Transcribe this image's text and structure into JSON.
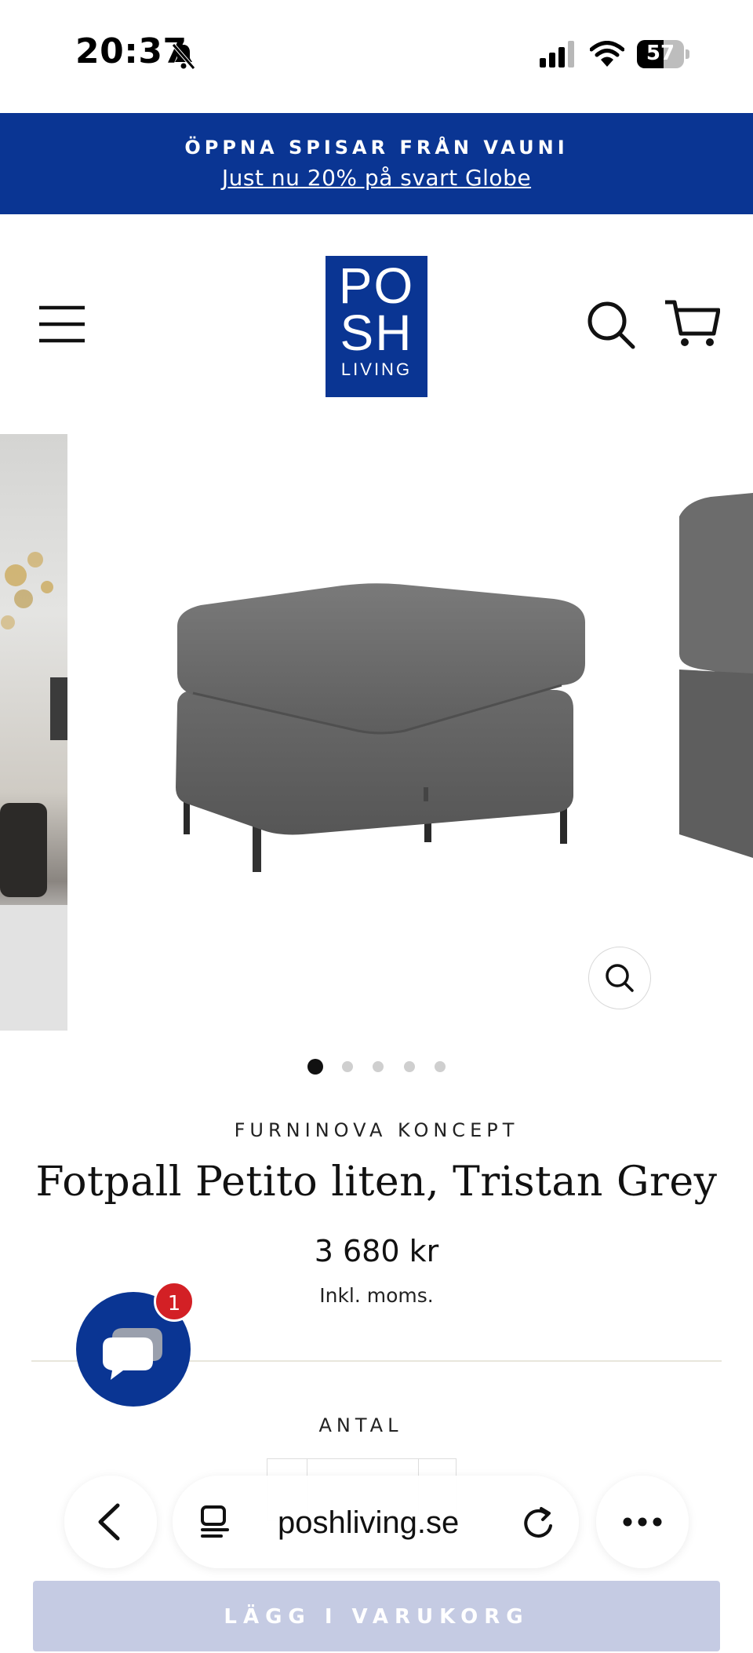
{
  "status_bar": {
    "time": "20:37",
    "battery": "57"
  },
  "promo": {
    "title": "ÖPPNA SPISAR FRÅN VAUNI",
    "link": "Just nu 20% på svart Globe",
    "color": "#0a3593"
  },
  "header": {
    "logo_line1": "PO",
    "logo_line2": "SH",
    "logo_line3": "LIVING"
  },
  "gallery": {
    "slide_count": 5,
    "active_index": 0
  },
  "product": {
    "vendor": "FURNINOVA KONCEPT",
    "title": "Fotpall Petito liten, Tristan Grey",
    "price": "3 680 kr",
    "tax_note": "Inkl. moms."
  },
  "chat": {
    "badge_count": "1"
  },
  "quantity": {
    "label": "ANTAL"
  },
  "safari": {
    "url": "poshliving.se"
  },
  "cart_button": {
    "label": "LÄGG I VARUKORG"
  },
  "colors": {
    "brand_blue": "#0a3593",
    "badge_red": "#d32025"
  }
}
